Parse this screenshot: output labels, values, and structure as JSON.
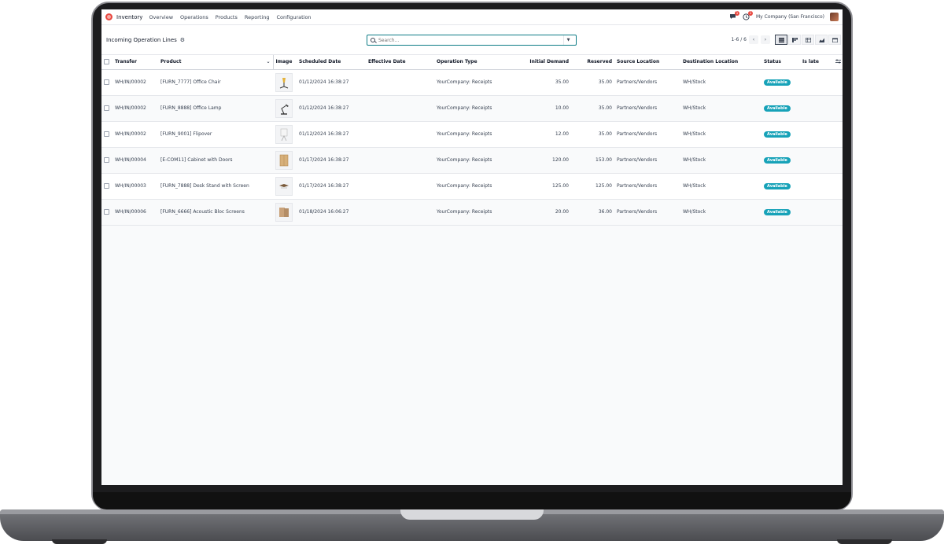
{
  "navbar": {
    "app_name": "Inventory",
    "menu": [
      "Overview",
      "Operations",
      "Products",
      "Reporting",
      "Configuration"
    ],
    "messages_count": "1",
    "activities_count": "1",
    "company": "My Company (San Francisco)"
  },
  "control": {
    "title": "Incoming Operation Lines",
    "search_placeholder": "Search...",
    "pager": "1-6 / 6"
  },
  "table": {
    "headers": {
      "transfer": "Transfer",
      "product": "Product",
      "image": "Image",
      "scheduled": "Scheduled Date",
      "effective": "Effective Date",
      "optype": "Operation Type",
      "demand": "Initial Demand",
      "reserved": "Reserved",
      "source": "Source Location",
      "dest": "Destination Location",
      "status": "Status",
      "late": "Is late"
    },
    "rows": [
      {
        "transfer": "WH/IN/00002",
        "product": "[FURN_7777] Office Chair",
        "image": "chair",
        "scheduled": "01/12/2024 16:38:27",
        "effective": "",
        "optype": "YourCompany: Receipts",
        "demand": "35.00",
        "reserved": "35.00",
        "source": "Partners/Vendors",
        "dest": "WH/Stock",
        "status": "Available"
      },
      {
        "transfer": "WH/IN/00002",
        "product": "[FURN_8888] Office Lamp",
        "image": "lamp",
        "scheduled": "01/12/2024 16:38:27",
        "effective": "",
        "optype": "YourCompany: Receipts",
        "demand": "10.00",
        "reserved": "35.00",
        "source": "Partners/Vendors",
        "dest": "WH/Stock",
        "status": "Available"
      },
      {
        "transfer": "WH/IN/00002",
        "product": "[FURN_9001] Flipover",
        "image": "flipover",
        "scheduled": "01/12/2024 16:38:27",
        "effective": "",
        "optype": "YourCompany: Receipts",
        "demand": "12.00",
        "reserved": "35.00",
        "source": "Partners/Vendors",
        "dest": "WH/Stock",
        "status": "Available"
      },
      {
        "transfer": "WH/IN/00004",
        "product": "[E-COM11] Cabinet with Doors",
        "image": "cabinet",
        "scheduled": "01/17/2024 16:38:27",
        "effective": "",
        "optype": "YourCompany: Receipts",
        "demand": "120.00",
        "reserved": "153.00",
        "source": "Partners/Vendors",
        "dest": "WH/Stock",
        "status": "Available"
      },
      {
        "transfer": "WH/IN/00003",
        "product": "[FURN_7888] Desk Stand with Screen",
        "image": "desk-stand",
        "scheduled": "01/17/2024 16:38:27",
        "effective": "",
        "optype": "YourCompany: Receipts",
        "demand": "125.00",
        "reserved": "125.00",
        "source": "Partners/Vendors",
        "dest": "WH/Stock",
        "status": "Available"
      },
      {
        "transfer": "WH/IN/00006",
        "product": "[FURN_6666] Acoustic Bloc Screens",
        "image": "screens",
        "scheduled": "01/18/2024 16:06:27",
        "effective": "",
        "optype": "YourCompany: Receipts",
        "demand": "20.00",
        "reserved": "36.00",
        "source": "Partners/Vendors",
        "dest": "WH/Stock",
        "status": "Available"
      }
    ]
  },
  "colors": {
    "accent": "#0e7c86",
    "badge": "#17a2b8",
    "logo": "#e8473f"
  }
}
